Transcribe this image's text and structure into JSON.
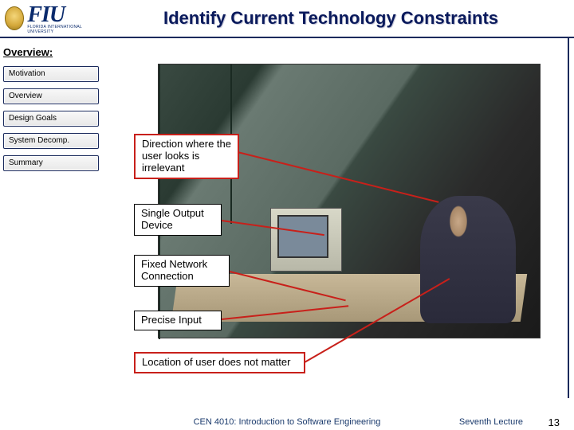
{
  "header": {
    "logo_text": "FIU",
    "logo_subtext": "FLORIDA INTERNATIONAL UNIVERSITY",
    "title": "Identify Current Technology Constraints"
  },
  "sidebar": {
    "section_label": "Overview:",
    "items": [
      {
        "label": "Motivation"
      },
      {
        "label": "Overview"
      },
      {
        "label": "Design Goals"
      },
      {
        "label": "System Decomp."
      },
      {
        "label": "Summary"
      }
    ]
  },
  "callouts": {
    "c1": "Direction where the user looks is irrelevant",
    "c2": "Single Output Device",
    "c3": "Fixed Network Connection",
    "c4": "Precise Input",
    "c5": "Location of user  does not matter"
  },
  "footer": {
    "course": "CEN 4010: Introduction to Software Engineering",
    "lecture": "Seventh Lecture",
    "page": "13"
  }
}
